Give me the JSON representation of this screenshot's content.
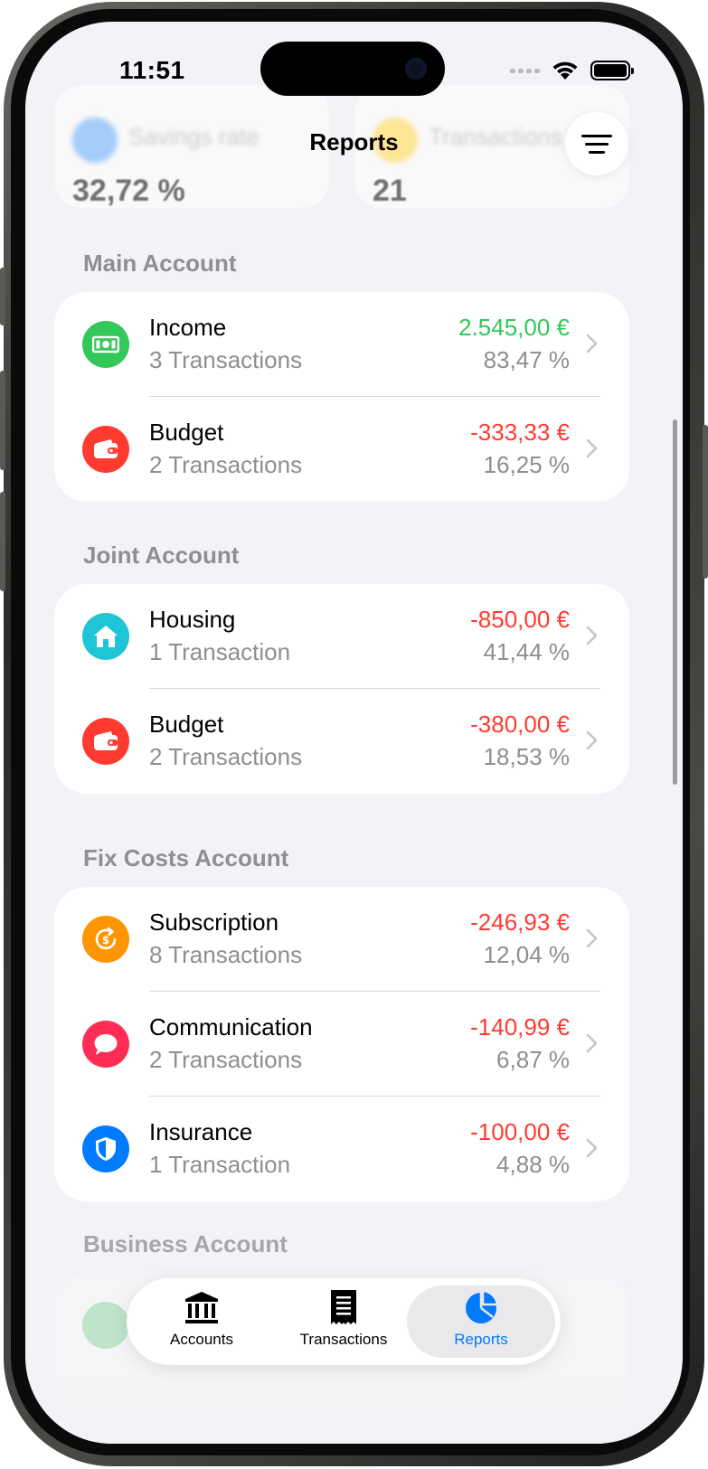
{
  "status": {
    "time": "11:51"
  },
  "nav": {
    "title": "Reports"
  },
  "summary": [
    {
      "label": "Savings rate",
      "value": "32,72 %",
      "icon_color": "#007aff"
    },
    {
      "label": "Transactions",
      "value": "21",
      "icon_color": "#ffcc00"
    }
  ],
  "sections": [
    {
      "title": "Main Account",
      "rows": [
        {
          "name": "Income",
          "count": "3 Transactions",
          "amount": "2.545,00 €",
          "pct": "83,47 %",
          "kind": "income",
          "icon": "money-icon",
          "color": "#34c759"
        },
        {
          "name": "Budget",
          "count": "2 Transactions",
          "amount": "-333,33 €",
          "pct": "16,25 %",
          "kind": "expense",
          "icon": "wallet-icon",
          "color": "#ff3b30"
        }
      ]
    },
    {
      "title": "Joint Account",
      "rows": [
        {
          "name": "Housing",
          "count": "1 Transaction",
          "amount": "-850,00 €",
          "pct": "41,44 %",
          "kind": "expense",
          "icon": "house-icon",
          "color": "#1fc4d6"
        },
        {
          "name": "Budget",
          "count": "2 Transactions",
          "amount": "-380,00 €",
          "pct": "18,53 %",
          "kind": "expense",
          "icon": "wallet-icon",
          "color": "#ff3b30"
        }
      ]
    },
    {
      "title": "Fix Costs Account",
      "rows": [
        {
          "name": "Subscription",
          "count": "8 Transactions",
          "amount": "-246,93 €",
          "pct": "12,04 %",
          "kind": "expense",
          "icon": "subscription-icon",
          "color": "#ff9500"
        },
        {
          "name": "Communication",
          "count": "2 Transactions",
          "amount": "-140,99 €",
          "pct": "6,87 %",
          "kind": "expense",
          "icon": "chat-bubble-icon",
          "color": "#ff2d55"
        },
        {
          "name": "Insurance",
          "count": "1 Transaction",
          "amount": "-100,00 €",
          "pct": "4,88 %",
          "kind": "expense",
          "icon": "shield-icon",
          "color": "#007aff"
        }
      ]
    },
    {
      "title": "Business Account",
      "rows": []
    }
  ],
  "tabs": [
    {
      "label": "Accounts",
      "icon": "bank-icon",
      "active": false
    },
    {
      "label": "Transactions",
      "icon": "receipt-icon",
      "active": false
    },
    {
      "label": "Reports",
      "icon": "pie-chart-icon",
      "active": true
    }
  ],
  "colors": {
    "accent": "#007aff",
    "positive": "#34c759",
    "negative": "#ff3b30"
  }
}
